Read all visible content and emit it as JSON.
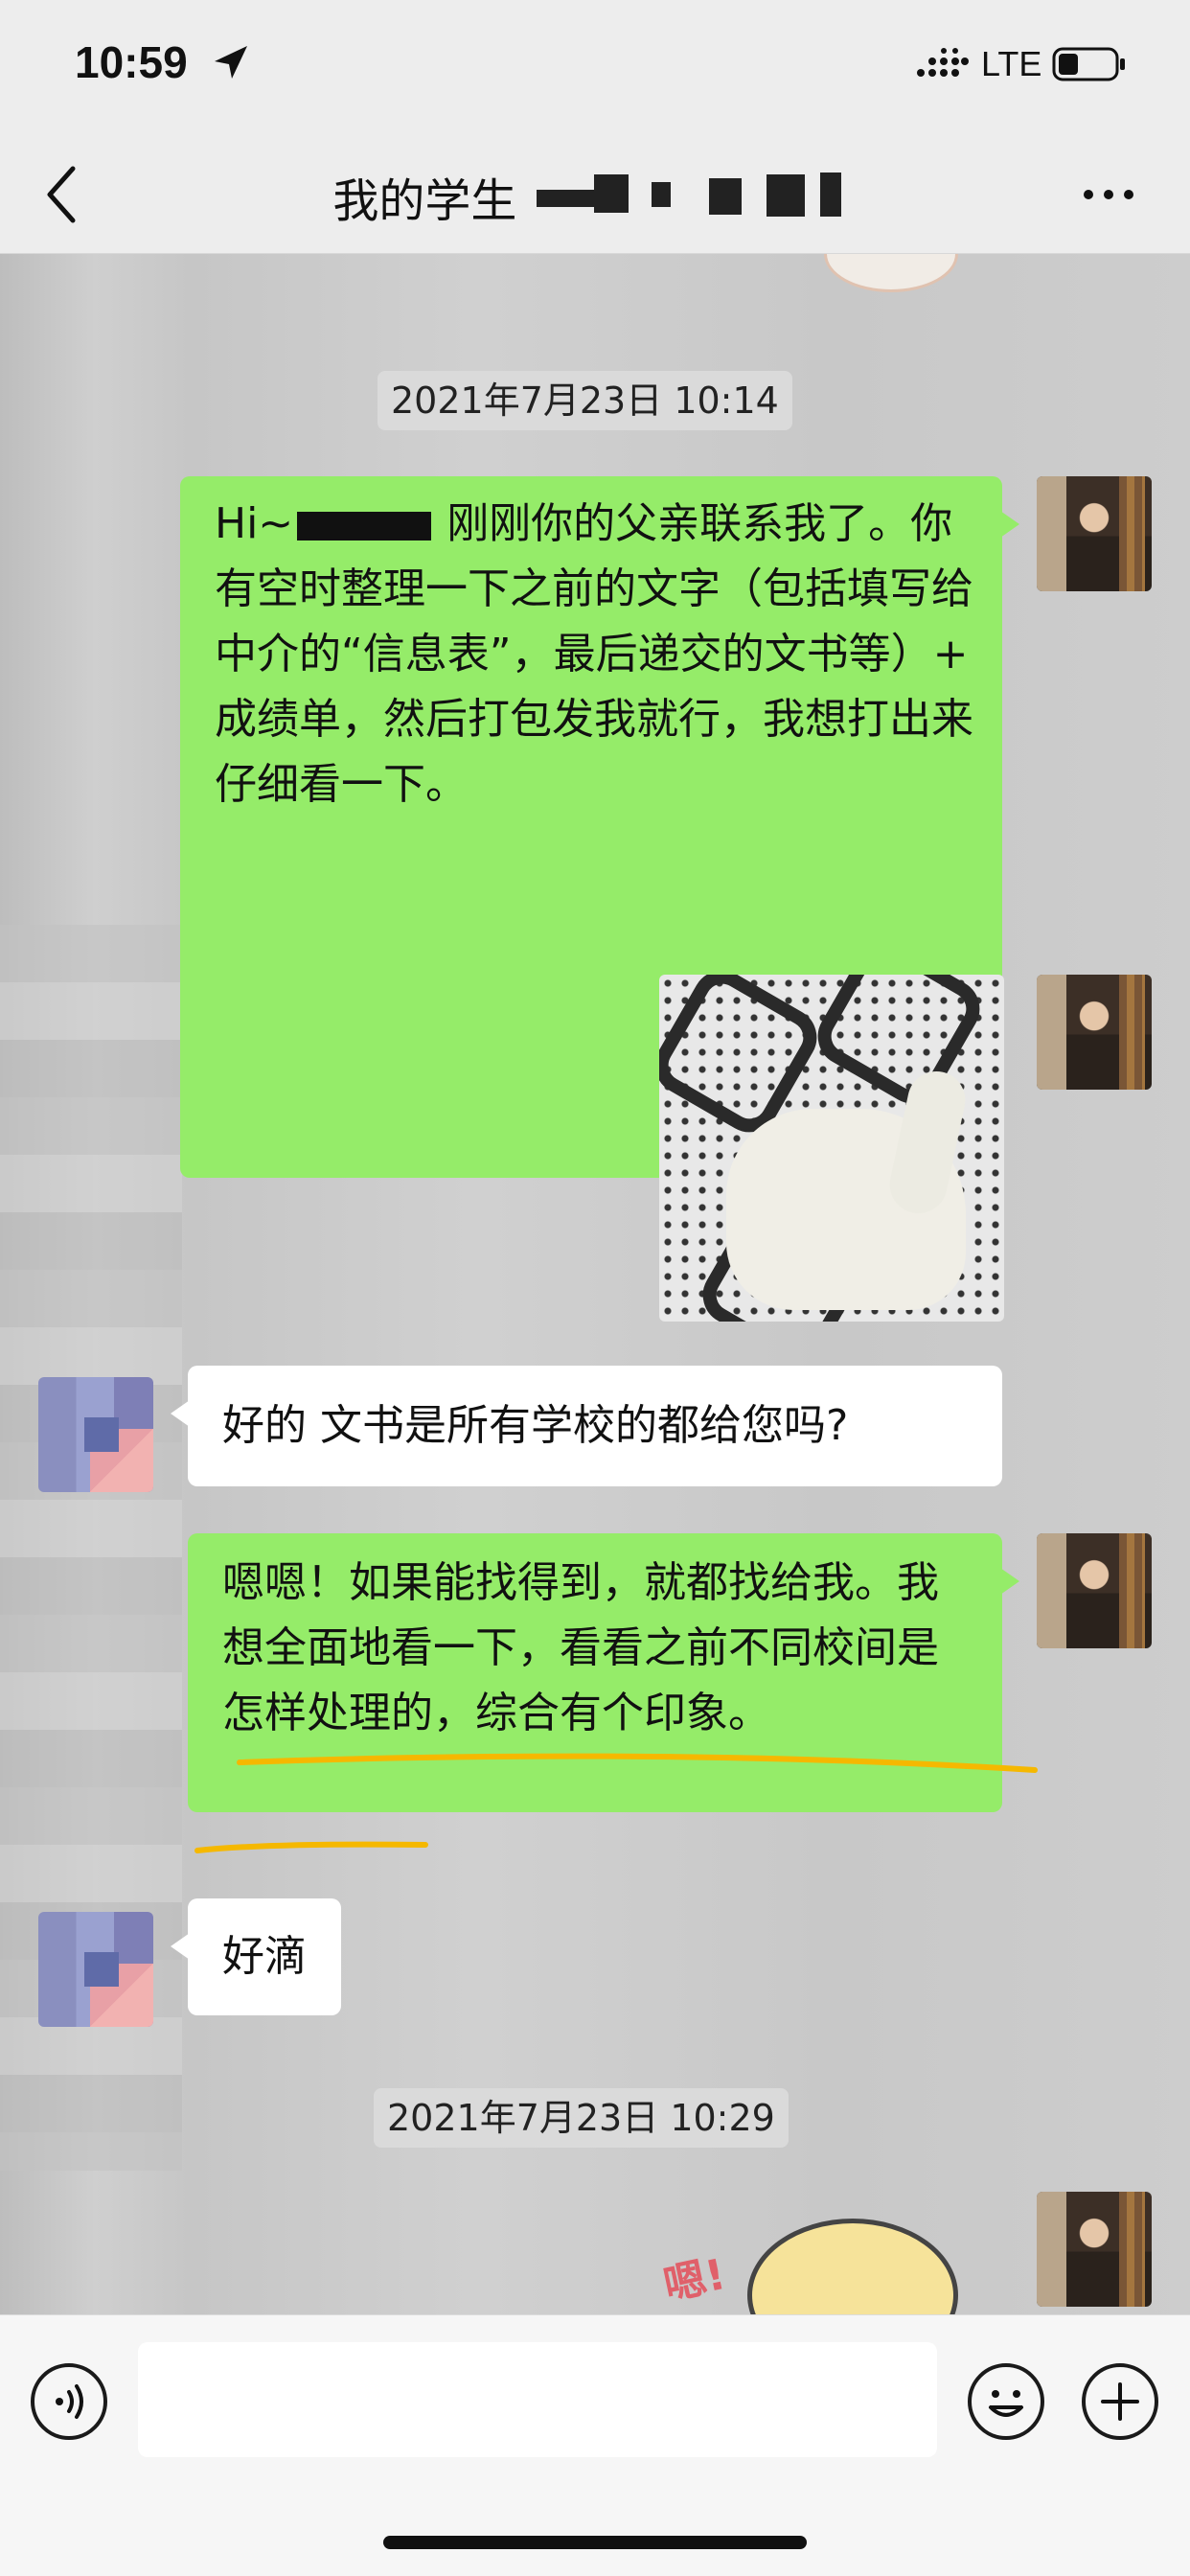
{
  "status_bar": {
    "time": "10:59",
    "network": "LTE",
    "icons": [
      "location-arrow-icon",
      "signal-icon",
      "battery-icon"
    ]
  },
  "nav": {
    "title": "我的学生",
    "icons": [
      "back-chevron-icon",
      "more-icon"
    ]
  },
  "messages": [
    {
      "kind": "timestamp",
      "text": "2021年7月23日 10:14"
    },
    {
      "kind": "text",
      "sender": "me",
      "prefix": "Hi~",
      "text": "刚刚你的父亲联系我了。你有空时整理一下之前的文字（包括填写给中介的“信息表”，最后递交的文书等）+ 成绩单，然后打包发我就行，我想打出来仔细看一下。"
    },
    {
      "kind": "image",
      "sender": "me",
      "description": ""
    },
    {
      "kind": "text",
      "sender": "other",
      "text": "好的 文书是所有学校的都给您吗?"
    },
    {
      "kind": "text",
      "sender": "me",
      "text": "嗯嗯！如果能找得到，就都找给我。我想全面地看一下，看看之前不同校间是怎样处理的，综合有个印象。"
    },
    {
      "kind": "text",
      "sender": "other",
      "text": "好滴"
    },
    {
      "kind": "timestamp",
      "text": "2021年7月23日 10:29"
    },
    {
      "kind": "sticker",
      "sender": "me",
      "text": "嗯!"
    }
  ],
  "input_bar": {
    "placeholder": "",
    "icons": [
      "voice-icon",
      "emoji-icon",
      "plus-icon"
    ]
  },
  "colors": {
    "my_bubble": "#95ec69",
    "other_bubble": "#ffffff",
    "chat_bg": "#c8c8c8",
    "highlight_underline": "#f5b800"
  }
}
